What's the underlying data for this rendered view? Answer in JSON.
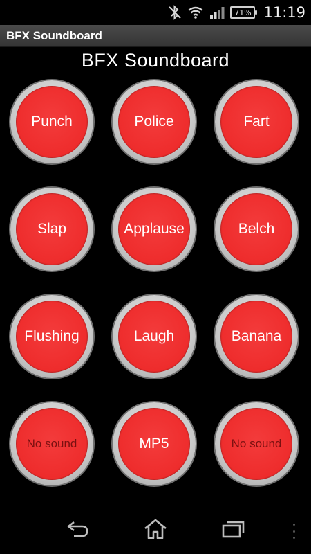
{
  "status_bar": {
    "icons": [
      "bluetooth-off-icon",
      "wifi-icon",
      "signal-icon",
      "battery-icon"
    ],
    "battery_level": "71%",
    "time": "11:19"
  },
  "app": {
    "title_bar": "BFX Soundboard",
    "heading": "BFX Soundboard"
  },
  "sounds": [
    {
      "label": "Punch"
    },
    {
      "label": "Police"
    },
    {
      "label": "Fart"
    },
    {
      "label": "Slap"
    },
    {
      "label": "Applause"
    },
    {
      "label": "Belch"
    },
    {
      "label": "Flushing"
    },
    {
      "label": "Laugh"
    },
    {
      "label": "Banana"
    },
    {
      "label": "No sound"
    },
    {
      "label": "MP5"
    },
    {
      "label": "No sound"
    }
  ],
  "nav_bar": {
    "icons": [
      "back-icon",
      "home-icon",
      "recent-apps-icon",
      "menu-overflow-icon"
    ]
  },
  "colors": {
    "button_red": "#ee2c2c",
    "button_ring": "#c9c9c9",
    "title_bar_bg": "#3e3e3e",
    "background": "#000000"
  }
}
